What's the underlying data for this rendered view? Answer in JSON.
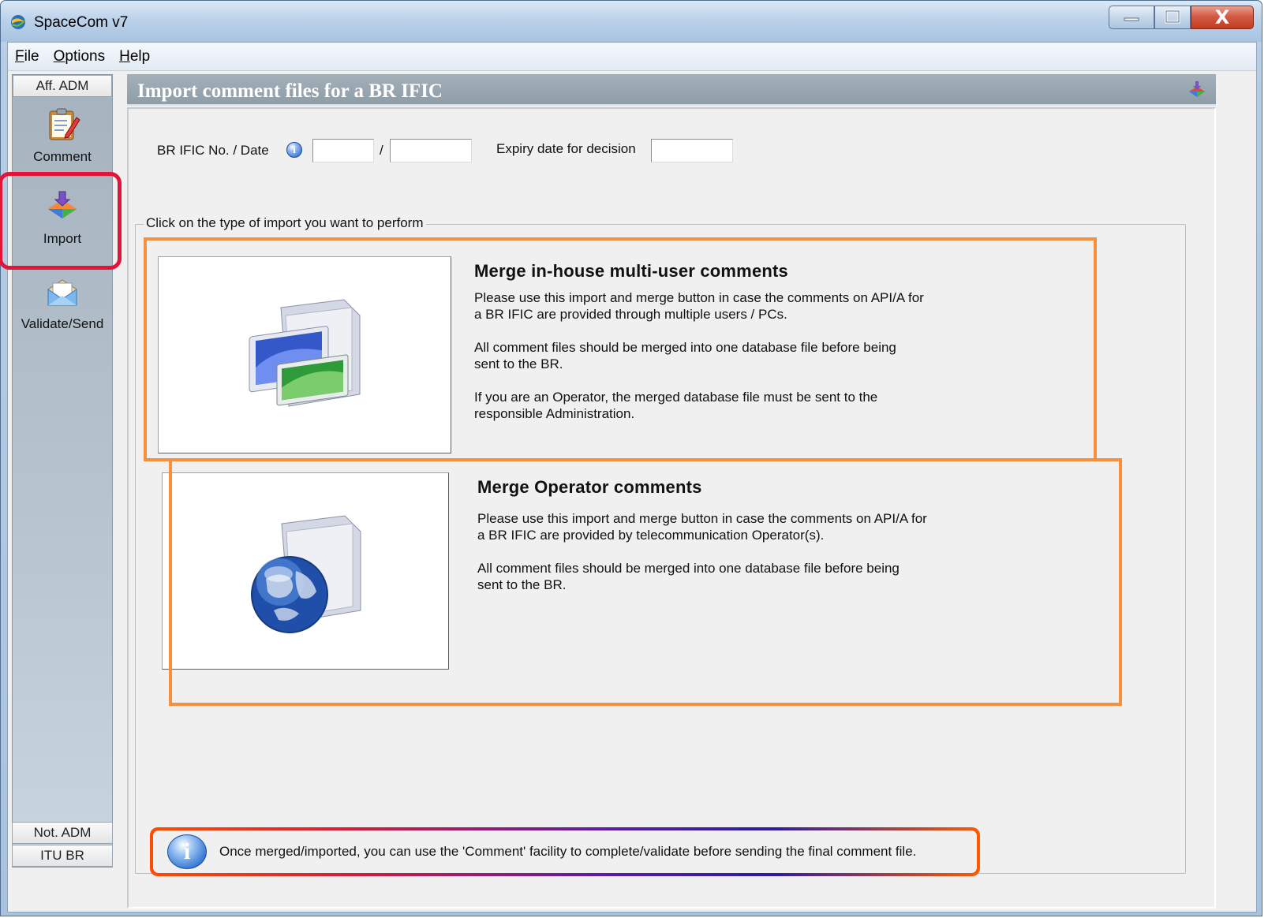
{
  "window": {
    "title": "SpaceCom v7",
    "controls": {
      "minimize_icon": "minimize-icon",
      "maximize_icon": "maximize-icon",
      "close_label": "X"
    }
  },
  "menu": {
    "items": [
      {
        "mnemonic": "F",
        "rest": "ile"
      },
      {
        "mnemonic": "O",
        "rest": "ptions"
      },
      {
        "mnemonic": "H",
        "rest": "elp"
      }
    ]
  },
  "sidebar": {
    "section_label": "Aff. ADM",
    "tools": [
      {
        "label": "Comment",
        "icon": "clipboard-edit-icon"
      },
      {
        "label": "Import",
        "icon": "import-diamond-icon"
      },
      {
        "label": "Validate/Send",
        "icon": "envelope-icon"
      }
    ],
    "bottom_tabs": [
      "Not. ADM",
      "ITU BR"
    ]
  },
  "panel": {
    "title": "Import comment files for a BR IFIC",
    "header_icon": "import-diamond-icon"
  },
  "form": {
    "br_ific_label": "BR IFIC No. / Date",
    "separator": "/",
    "br_ific_no": "",
    "br_ific_date": "",
    "expiry_label": "Expiry date for decision",
    "expiry_value": ""
  },
  "import_group": {
    "legend": "Click on the type of import you want to perform",
    "options": [
      {
        "title": "Merge in-house multi-user comments",
        "icon": "folder-monitor-icon",
        "paragraphs": [
          "Please use this import and merge button in case the comments on API/A for a BR IFIC are provided through multiple users / PCs.",
          "All comment files should be merged into one database file before being sent to the BR.",
          "If you are an Operator, the merged database file must be sent to the responsible Administration."
        ]
      },
      {
        "title": "Merge Operator comments",
        "icon": "folder-globe-icon",
        "paragraphs": [
          "Please use this import and merge button in case the comments on API/A for a BR IFIC are provided by telecommunication Operator(s).",
          "All comment files should be merged into one database file before being sent to the BR."
        ]
      }
    ]
  },
  "notice": {
    "text": "Once merged/imported, you can use the 'Comment' facility to complete/validate before sending the final comment file."
  },
  "colors": {
    "highlight_orange": "#f5903e",
    "highlight_red": "#e3143a",
    "panel_header": "#9aa7b1"
  }
}
